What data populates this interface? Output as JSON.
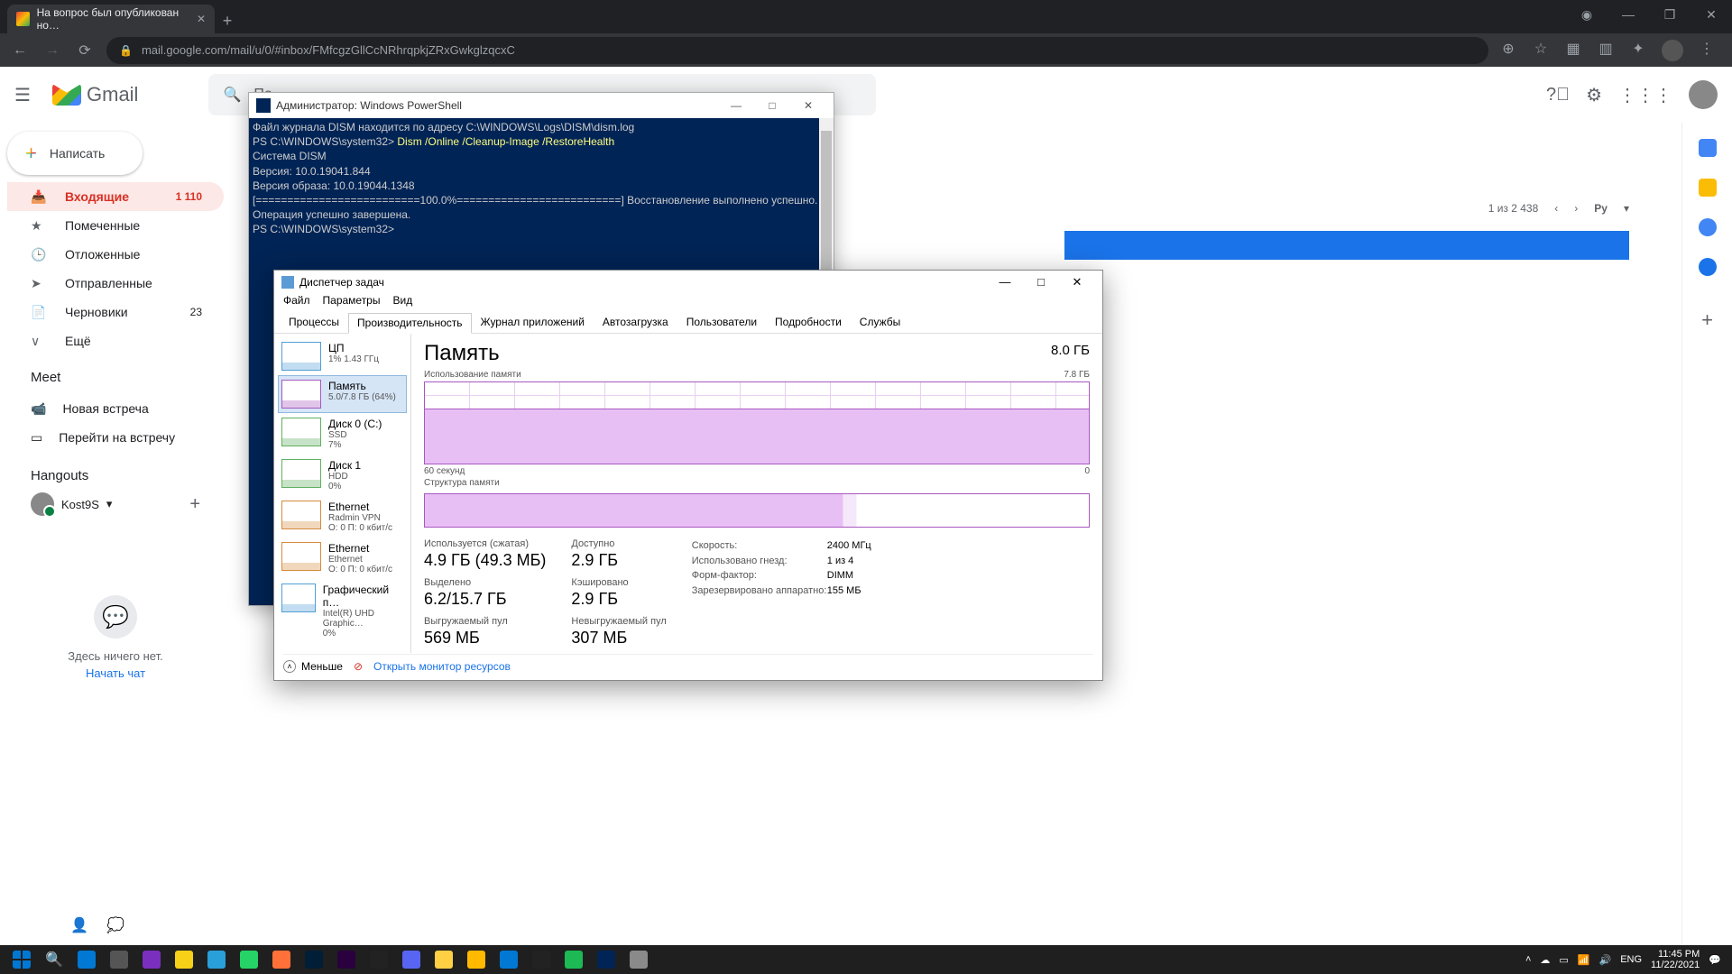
{
  "browser": {
    "tab_title": "На вопрос был опубликован но…",
    "url": "mail.google.com/mail/u/0/#inbox/FMfcgzGllCcNRhrqpkjZRxGwkglzqcxC"
  },
  "gmail": {
    "logo": "Gmail",
    "search_placeholder": "По…",
    "compose": "Написать",
    "pager": "1 из 2 438",
    "lang_badge": "Ру",
    "folders": [
      {
        "icon": "📥",
        "label": "Входящие",
        "count": "1 110",
        "active": true
      },
      {
        "icon": "★",
        "label": "Помеченные",
        "count": ""
      },
      {
        "icon": "🕒",
        "label": "Отложенные",
        "count": ""
      },
      {
        "icon": "➤",
        "label": "Отправленные",
        "count": ""
      },
      {
        "icon": "📄",
        "label": "Черновики",
        "count": "23"
      },
      {
        "icon": "∨",
        "label": "Ещё",
        "count": ""
      }
    ],
    "meet": {
      "title": "Meet",
      "new": "Новая встреча",
      "join": "Перейти на встречу"
    },
    "hangouts": {
      "title": "Hangouts",
      "user": "Kost9S",
      "empty1": "Здесь ничего нет.",
      "empty2": "Начать чат"
    }
  },
  "powershell": {
    "title": "Администратор: Windows PowerShell",
    "lines": [
      "Файл журнала DISM находится по адресу C:\\WINDOWS\\Logs\\DISM\\dism.log",
      "PS C:\\WINDOWS\\system32> ",
      "",
      "Cистема DISM",
      "Версия: 10.0.19041.844",
      "",
      "Версия образа: 10.0.19044.1348",
      "",
      "[==========================100.0%==========================] Восстановление выполнено успешно.",
      "Операция успешно завершена.",
      "PS C:\\WINDOWS\\system32>"
    ],
    "cmd": "Dism /Online /Cleanup-Image /RestoreHealth"
  },
  "taskmgr": {
    "title": "Диспетчер задач",
    "menu": [
      "Файл",
      "Параметры",
      "Вид"
    ],
    "tabs": [
      "Процессы",
      "Производительность",
      "Журнал приложений",
      "Автозагрузка",
      "Пользователи",
      "Подробности",
      "Службы"
    ],
    "active_tab": 1,
    "side": [
      {
        "cls": "cpu",
        "t": "ЦП",
        "s": "1%  1.43 ГГц"
      },
      {
        "cls": "mem",
        "t": "Память",
        "s": "5.0/7.8 ГБ (64%)",
        "sel": true
      },
      {
        "cls": "disk",
        "t": "Диск 0 (C:)",
        "s": "SSD\n7%"
      },
      {
        "cls": "disk",
        "t": "Диск 1",
        "s": "HDD\n0%"
      },
      {
        "cls": "eth",
        "t": "Ethernet",
        "s": "Radmin VPN\nО: 0 П: 0 кбит/с"
      },
      {
        "cls": "eth",
        "t": "Ethernet",
        "s": "Ethernet\nО: 0 П: 0 кбит/с"
      },
      {
        "cls": "cpu",
        "t": "Графический п…",
        "s": "Intel(R) UHD Graphic…\n0%"
      }
    ],
    "heading": "Память",
    "total": "8.0 ГБ",
    "chart1_label": "Использование памяти",
    "chart1_max": "7.8 ГБ",
    "chart2_label": "Структура памяти",
    "axis_l": "60 секунд",
    "axis_r": "0",
    "stats": {
      "used_lbl": "Используется (сжатая)",
      "used_val": "4.9 ГБ (49.3 МБ)",
      "avail_lbl": "Доступно",
      "avail_val": "2.9 ГБ",
      "alloc_lbl": "Выделено",
      "alloc_val": "6.2/15.7 ГБ",
      "cache_lbl": "Кэшировано",
      "cache_val": "2.9 ГБ",
      "pg_lbl": "Выгружаемый пул",
      "pg_val": "569 МБ",
      "npg_lbl": "Невыгружаемый пул",
      "npg_val": "307 МБ"
    },
    "kv": [
      {
        "k": "Скорость:",
        "v": "2400 МГц"
      },
      {
        "k": "Использовано гнезд:",
        "v": "1 из 4"
      },
      {
        "k": "Форм-фактор:",
        "v": "DIMM"
      },
      {
        "k": "Зарезервировано аппаратно:",
        "v": "155 МБ"
      }
    ],
    "less": "Меньше",
    "monitor": "Открыть монитор ресурсов"
  },
  "taskbar": {
    "lang": "ENG",
    "time": "11:45 PM",
    "date": "11/22/2021",
    "apps": [
      "#0078d4",
      "#555",
      "#7b2fbf",
      "#f7d117",
      "#29a0da",
      "#25d366",
      "#ff7139",
      "#001e36",
      "#2a003f",
      "#222",
      "#5865f2",
      "#ffcf44",
      "#ffb900",
      "#0078d4",
      "#222",
      "#1db954",
      "#012456",
      "#8a8a8a"
    ]
  }
}
